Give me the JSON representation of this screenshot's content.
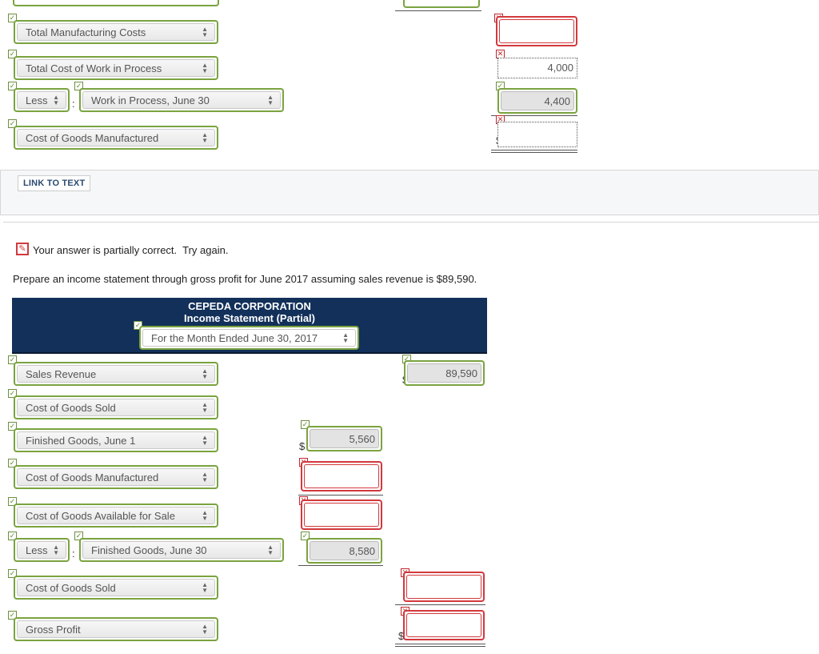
{
  "top_section": {
    "rows": [
      {
        "label": "Total Manufacturing Costs",
        "status": "correct"
      },
      {
        "label": "Total Cost of Work in Process",
        "status": "correct"
      },
      {
        "prefix": "Less",
        "label": "Work in Process, June 30",
        "status": "correct"
      },
      {
        "label": "Cost of Goods Manufactured",
        "status": "correct"
      }
    ],
    "amounts": [
      {
        "value": "",
        "status": "incorrect"
      },
      {
        "value": "4,000",
        "status": "incorrect"
      },
      {
        "value": "4,400",
        "status": "correct"
      },
      {
        "value": "",
        "status": "incorrect",
        "currency": "$"
      }
    ],
    "link_to_text": "LINK TO TEXT"
  },
  "feedback": {
    "message": "Your answer is partially correct.  Try again."
  },
  "question": "Prepare an income statement through gross profit for June 2017 assuming sales revenue is $89,590.",
  "statement": {
    "company": "CEPEDA CORPORATION",
    "title": "Income Statement (Partial)",
    "period": "For the Month Ended June 30, 2017",
    "rows": [
      {
        "label": "Sales Revenue",
        "status": "correct"
      },
      {
        "label": "Cost of Goods Sold",
        "status": "correct"
      },
      {
        "label": "Finished Goods, June 1",
        "status": "correct"
      },
      {
        "label": "Cost of Goods Manufactured",
        "status": "correct"
      },
      {
        "label": "Cost of Goods Available for Sale",
        "status": "correct"
      },
      {
        "prefix": "Less",
        "label": "Finished Goods, June 30",
        "status": "correct"
      },
      {
        "label": "Cost of Goods Sold",
        "status": "correct"
      },
      {
        "label": "Gross Profit",
        "status": "correct"
      }
    ],
    "col1_amounts": [
      {
        "value": "5,560",
        "status": "correct",
        "currency": "$"
      },
      {
        "value": "",
        "status": "incorrect"
      },
      {
        "value": "",
        "status": "incorrect"
      },
      {
        "value": "8,580",
        "status": "correct"
      }
    ],
    "col2_amounts": [
      {
        "value": "89,590",
        "status": "correct",
        "currency": "$"
      },
      {
        "value": "",
        "status": "incorrect"
      },
      {
        "value": "",
        "status": "incorrect",
        "currency": "$"
      }
    ]
  },
  "symbols": {
    "check": "✓",
    "cross": "✕",
    "colon": ":",
    "pencil": "✎"
  }
}
